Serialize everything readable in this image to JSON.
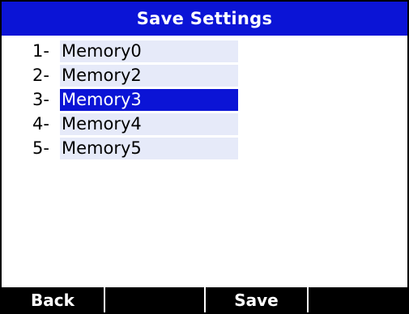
{
  "header": {
    "title": "Save Settings"
  },
  "list": {
    "items": [
      {
        "number": "1-",
        "label": "Memory0",
        "selected": false
      },
      {
        "number": "2-",
        "label": "Memory2",
        "selected": false
      },
      {
        "number": "3-",
        "label": "Memory3",
        "selected": true
      },
      {
        "number": "4-",
        "label": "Memory4",
        "selected": false
      },
      {
        "number": "5-",
        "label": "Memory5",
        "selected": false
      }
    ]
  },
  "softkeys": {
    "key1": "Back",
    "key2": "",
    "key3": "Save",
    "key4": ""
  },
  "colors": {
    "accent": "#0b14d6",
    "field_background": "#e6eaf9",
    "softkey_bar": "#000000"
  }
}
